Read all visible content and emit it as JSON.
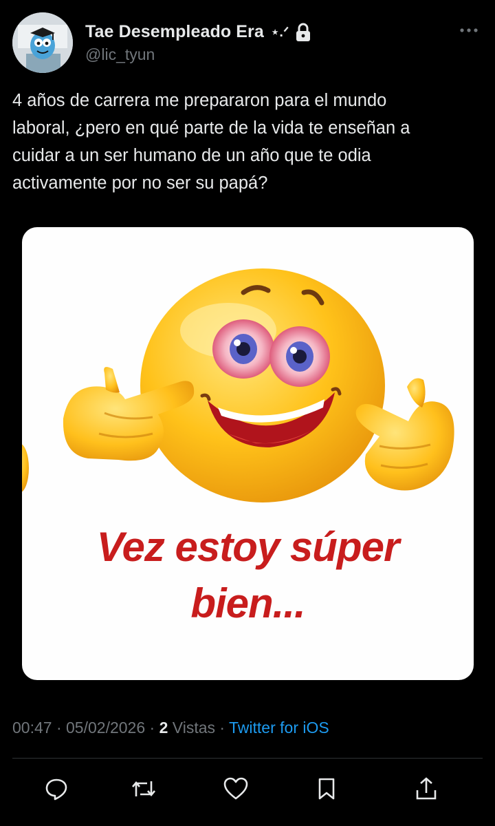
{
  "author": {
    "display_name": "Tae Desempleado Era",
    "name_suffix": "⋆.ᐟ",
    "handle": "@lic_tyun",
    "avatar_icon": "cartoon-avatar",
    "locked_icon": "lock-icon"
  },
  "tweet": {
    "text_lines": [
      "4 años de carrera me prepararon para el mundo",
      "laboral, ¿pero en qué parte de la vida te enseñan a",
      "cuidar a un ser humano de un año que te odia",
      "activamente por no ser su papá?"
    ]
  },
  "media": {
    "caption_line1": "Vez estoy súper",
    "caption_line2": "bien..."
  },
  "meta": {
    "time": "00:47",
    "sep1": " · ",
    "date": "05/02/2026",
    "sep2": " · ",
    "views_count": "2",
    "views_label": " Vistas",
    "sep3": " · ",
    "source": "Twitter for iOS"
  },
  "actions": [
    "reply-icon",
    "retweet-icon",
    "like-icon",
    "bookmark-icon",
    "share-icon"
  ],
  "colors": {
    "background": "#000000",
    "text": "#e7e9ea",
    "muted": "#71767b",
    "link": "#1d9bf0",
    "caption": "#c81d1d"
  }
}
